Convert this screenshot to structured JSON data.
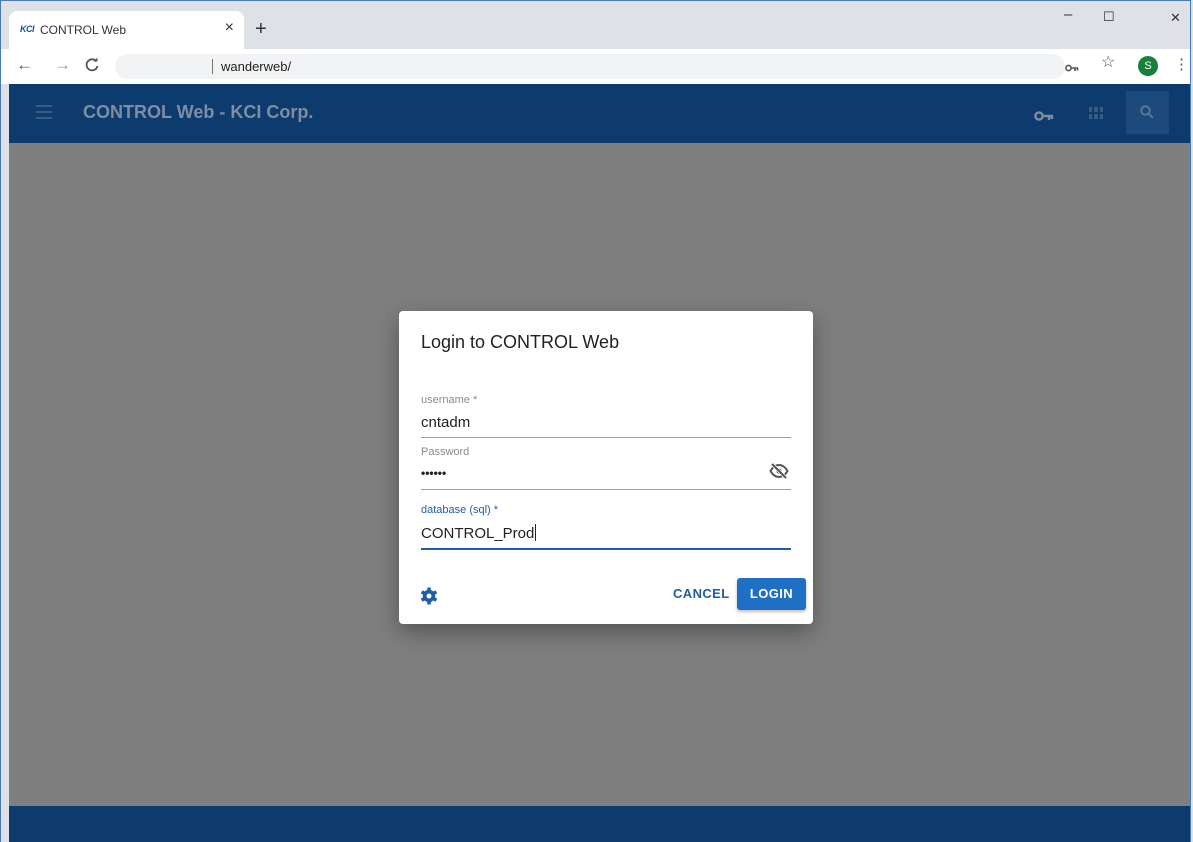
{
  "browser": {
    "tab": {
      "favicon_text": "KCI",
      "title": "CONTROL Web",
      "close": "×"
    },
    "new_tab": "+",
    "window_controls": {
      "minimize": "–",
      "maximize": "☐",
      "close": "✕"
    },
    "nav": {
      "back": "←",
      "forward": "→",
      "reload": "C"
    },
    "address": "wanderweb/",
    "toolbar_icons": {
      "key": "⚿",
      "star": "☆"
    },
    "profile_initial": "S",
    "menu": "⋮"
  },
  "app": {
    "title": "CONTROL Web - KCI Corp.",
    "colors": {
      "app_bar": "#0d3b6e",
      "backdrop": "#7f7f7f",
      "accent": "#1e5ea8",
      "login_button": "#1f6fc4"
    }
  },
  "dialog": {
    "title": "Login to CONTROL Web",
    "fields": {
      "username": {
        "label": "username *",
        "value": "cntadm"
      },
      "password": {
        "label": "Password",
        "value": "••••••"
      },
      "database": {
        "label": "database (sql) *",
        "value": "CONTROL_Prod"
      }
    },
    "buttons": {
      "cancel": "CANCEL",
      "login": "LOGIN"
    }
  }
}
